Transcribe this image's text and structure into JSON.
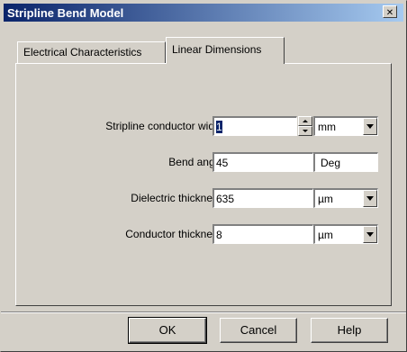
{
  "window": {
    "title": "Stripline Bend Model",
    "close_label": "✕"
  },
  "tabs": [
    {
      "label": "Electrical Characteristics",
      "active": false
    },
    {
      "label": "Linear Dimensions",
      "active": true
    }
  ],
  "fields": {
    "conductor_width": {
      "label": "Stripline conductor width",
      "value": "1",
      "unit": "mm"
    },
    "bend_angle": {
      "label": "Bend angle",
      "value": "45",
      "unit": "Deg"
    },
    "dielectric_thickness": {
      "label": "Dielectric thickness",
      "value": "635",
      "unit": "µm"
    },
    "conductor_thickness": {
      "label": "Conductor thickness",
      "value": "8",
      "unit": "µm"
    }
  },
  "buttons": {
    "ok": "OK",
    "cancel": "Cancel",
    "help": "Help"
  }
}
